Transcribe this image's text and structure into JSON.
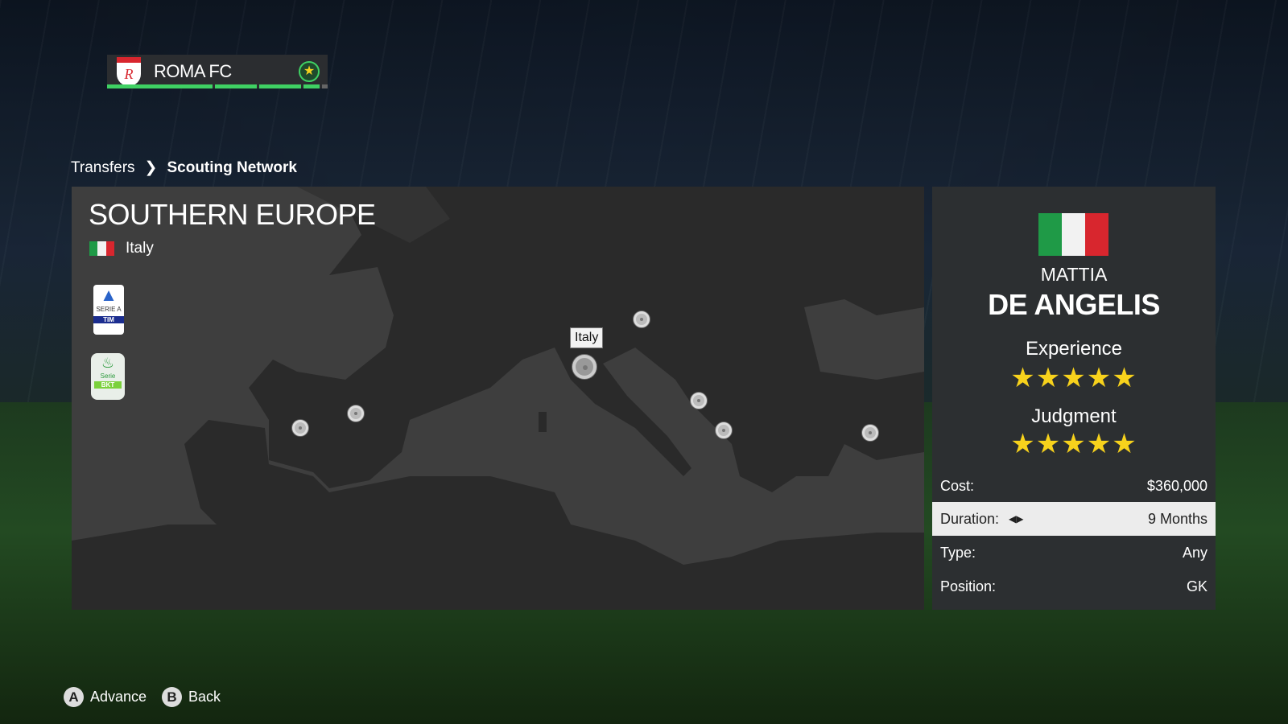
{
  "header": {
    "club_name": "ROMA FC",
    "crest_text": "R",
    "star_icon": "star-badge-icon",
    "progress_segments": [
      1,
      1,
      1,
      0.6
    ]
  },
  "breadcrumb": {
    "items": [
      "Transfers",
      "Scouting Network"
    ]
  },
  "map": {
    "region_title": "SOUTHERN EUROPE",
    "country": "Italy",
    "flag_colors": [
      "#1f9a47",
      "#f2f2f2",
      "#d8262e"
    ],
    "leagues": [
      {
        "name": "SERIE A",
        "sponsor": "TIM"
      },
      {
        "name": "Serie",
        "sponsor": "BKT"
      }
    ],
    "tooltip": "Italy"
  },
  "scout": {
    "first_name": "MATTIA",
    "last_name": "DE ANGELIS",
    "experience_label": "Experience",
    "experience_stars": 5,
    "experience_display": "★★★★★",
    "judgment_label": "Judgment",
    "judgment_stars": 5,
    "judgment_display": "★★★★★",
    "details": [
      {
        "label": "Cost:",
        "value": "$360,000"
      },
      {
        "label": "Duration:",
        "value": "9 Months"
      },
      {
        "label": "Type:",
        "value": "Any"
      },
      {
        "label": "Position:",
        "value": "GK"
      }
    ]
  },
  "footer": {
    "advance_key": "A",
    "advance_label": "Advance",
    "back_key": "B",
    "back_label": "Back"
  }
}
